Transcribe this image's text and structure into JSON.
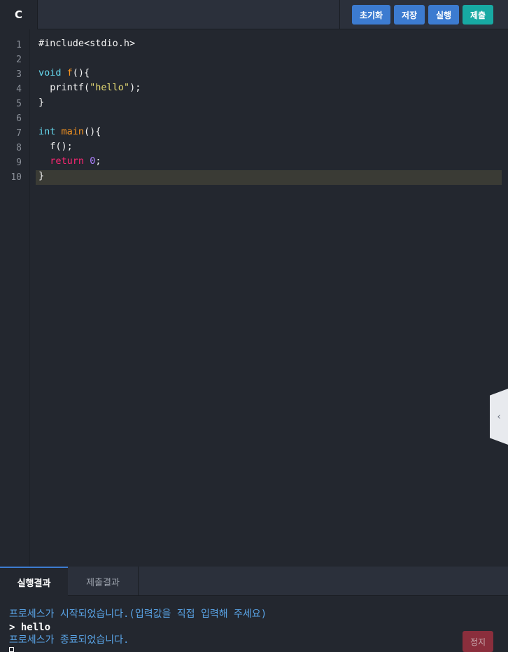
{
  "editor_tab": {
    "language": "C"
  },
  "toolbar": {
    "reset_label": "초기화",
    "save_label": "저장",
    "run_label": "실행",
    "submit_label": "제출"
  },
  "editor": {
    "line_numbers": [
      "1",
      "2",
      "3",
      "4",
      "5",
      "6",
      "7",
      "8",
      "9",
      "10"
    ],
    "active_line": 10,
    "code": {
      "l1": "#include<stdio.h>",
      "l3_type": "void",
      "l3_fn": "f",
      "l3_rest": "(){",
      "l4_call": "printf(",
      "l4_str": "\"hello\"",
      "l4_end": ");",
      "l5": "}",
      "l7_type": "int",
      "l7_fn": "main",
      "l7_rest": "(){",
      "l8": "f();",
      "l9_kw": "return",
      "l9_num": "0",
      "l9_end": ";",
      "l10": "}"
    },
    "side_handle_label": "‹"
  },
  "bottom": {
    "tabs": [
      {
        "label": "실행결과",
        "active": true
      },
      {
        "label": "제출결과",
        "active": false
      }
    ],
    "console_lines": [
      "프로세스가 시작되었습니다.(입력값을 직접 입력해 주세요)",
      "> hello",
      "프로세스가 종료되었습니다."
    ],
    "stop_label": "정지"
  },
  "colors": {
    "background": "#23272f",
    "toolbar_blue": "#3c7bd0",
    "submit_teal": "#17a9a3",
    "stop_red": "#8a2e3c",
    "console_info": "#5aa5e8"
  }
}
